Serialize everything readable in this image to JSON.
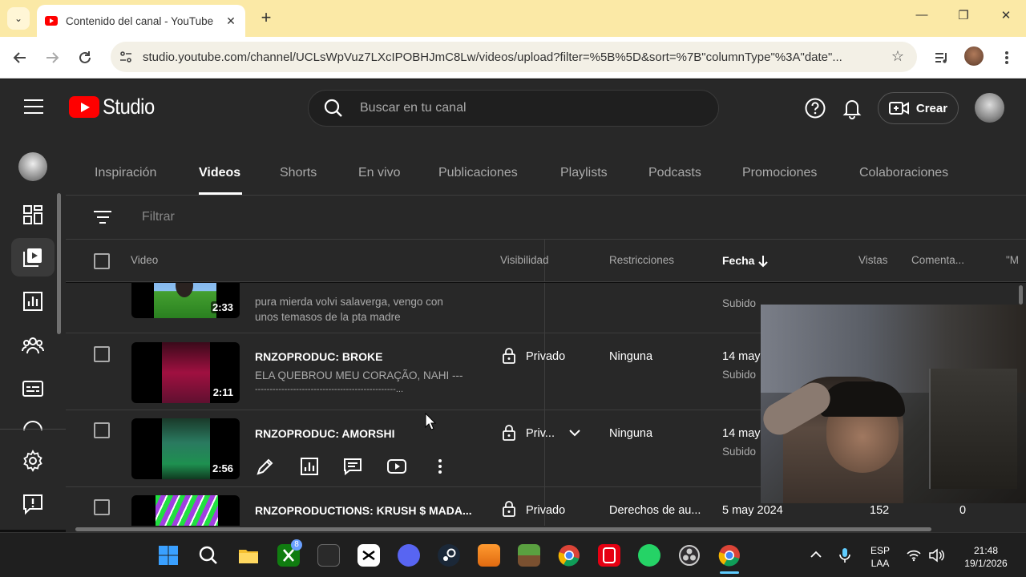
{
  "browser": {
    "tab_title": "Contenido del canal - YouTube",
    "tab_close": "✕",
    "new_tab": "+",
    "url": "studio.youtube.com/channel/UCLsWpVuz7LXcIPOBHJmC8Lw/videos/upload?filter=%5B%5D&sort=%7B\"columnType\"%3A\"date\"...",
    "window_controls": [
      "—",
      "❐",
      "✕"
    ]
  },
  "header": {
    "logo_text": "Studio",
    "search_placeholder": "Buscar en tu canal",
    "create_label": "Crear"
  },
  "tabs": [
    "Inspiración",
    "Videos",
    "Shorts",
    "En vivo",
    "Publicaciones",
    "Playlists",
    "Podcasts",
    "Promociones",
    "Colaboraciones"
  ],
  "active_tab": "Videos",
  "filter": {
    "placeholder": "Filtrar"
  },
  "table": {
    "columns": {
      "video": "Video",
      "visibility": "Visibilidad",
      "restrictions": "Restricciones",
      "date": "Fecha",
      "views": "Vistas",
      "comments": "Comenta...",
      "likes": "\"M"
    },
    "rows": [
      {
        "duration": "2:33",
        "description": "pura mierda volvi salaverga, vengo con unos temasos de la pta madre",
        "date_status": "Subido"
      },
      {
        "title": "RNZOPRODUC: BROKE",
        "description": "ELA QUEBROU MEU CORAÇÃO, NAHI ------",
        "description2": "------------------------------------------------...",
        "duration": "2:11",
        "visibility": "Privado",
        "restrictions": "Ninguna",
        "date": "14 may",
        "date_status": "Subido"
      },
      {
        "title": "RNZOPRODUC: AMORSHI",
        "duration": "2:56",
        "visibility": "Priv...",
        "restrictions": "Ninguna",
        "date": "14 may",
        "date_status": "Subido"
      },
      {
        "title": "RNZOPRODUCTIONS: KRUSH $ MADA...",
        "visibility": "Privado",
        "restrictions": "Derechos de au...",
        "date": "5 may 2024",
        "views": "152",
        "comments": "0"
      }
    ]
  },
  "taskbar": {
    "lang_line1": "ESP",
    "lang_line2": "LAA",
    "time": "21:48",
    "date": "19/1/2026",
    "xbox_badge": "8"
  }
}
